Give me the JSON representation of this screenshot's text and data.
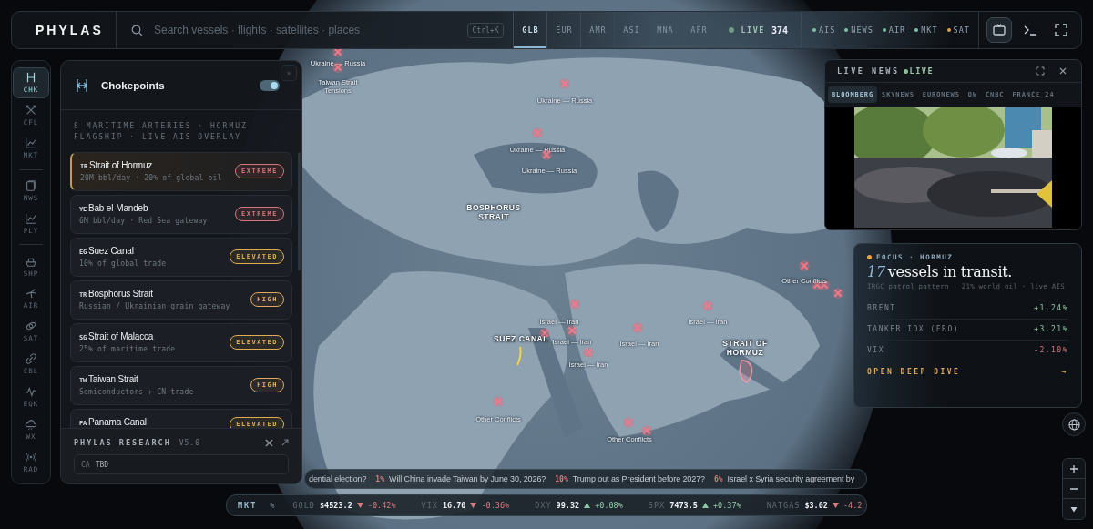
{
  "topbar": {
    "brand": "PHYLAS",
    "search": {
      "placeholder": "Search vessels · flights · satellites · places",
      "shortcut": "Ctrl+K"
    },
    "regions": [
      {
        "label": "GLB",
        "selected": true
      },
      {
        "label": "EUR",
        "selected": false
      },
      {
        "label": "AMR",
        "selected": false
      },
      {
        "label": "ASI",
        "selected": false
      },
      {
        "label": "MNA",
        "selected": false
      },
      {
        "label": "AFR",
        "selected": false
      }
    ],
    "live": {
      "label": "LIVE",
      "count": "374"
    },
    "layers": [
      {
        "label": "AIS",
        "color": "#7fc4a4"
      },
      {
        "label": "NEWS",
        "color": "#7fc4a4"
      },
      {
        "label": "AIR",
        "color": "#7fc4a4"
      },
      {
        "label": "MKT",
        "color": "#7fc4a4"
      },
      {
        "label": "SAT",
        "color": "#e0a050"
      }
    ],
    "tools": [
      {
        "kind": "tv",
        "selected": true
      },
      {
        "kind": "terminal",
        "selected": false
      },
      {
        "kind": "fullscreen",
        "selected": false
      }
    ]
  },
  "sidebar": {
    "groups": [
      {
        "items": [
          {
            "label": "CHK",
            "selected": true
          },
          {
            "label": "CFL",
            "selected": false
          },
          {
            "label": "MKT",
            "selected": false
          }
        ]
      },
      {
        "items": [
          {
            "label": "NWS",
            "selected": false
          },
          {
            "label": "PLY",
            "selected": false
          }
        ]
      },
      {
        "items": [
          {
            "label": "SHP",
            "selected": false
          },
          {
            "label": "AIR",
            "selected": false
          },
          {
            "label": "SAT",
            "selected": false
          },
          {
            "label": "CBL",
            "selected": false
          },
          {
            "label": "EQK",
            "selected": false
          },
          {
            "label": "WX",
            "selected": false
          },
          {
            "label": "RAD",
            "selected": false
          }
        ]
      }
    ]
  },
  "chokepoints": {
    "title": "Chokepoints",
    "enabled": true,
    "description": "8 MARITIME ARTERIES · HORMUZ FLAGSHIP · LIVE AIS OVERLAY",
    "items": [
      {
        "code": "IR",
        "name": "Strait of Hormuz",
        "detail": "20M bbl/day · 20% of global oil",
        "severity": "EXTREME",
        "kind": "extreme",
        "selected": true
      },
      {
        "code": "YE",
        "name": "Bab el-Mandeb",
        "detail": "6M bbl/day · Red Sea gateway",
        "severity": "EXTREME",
        "kind": "extreme",
        "selected": false
      },
      {
        "code": "EG",
        "name": "Suez Canal",
        "detail": "10% of global trade",
        "severity": "ELEVATED",
        "kind": "elevated",
        "selected": false
      },
      {
        "code": "TR",
        "name": "Bosphorus Strait",
        "detail": "Russian / Ukrainian grain gateway",
        "severity": "HIGH",
        "kind": "high",
        "selected": false
      },
      {
        "code": "SG",
        "name": "Strait of Malacca",
        "detail": "25% of maritime trade",
        "severity": "ELEVATED",
        "kind": "elevated",
        "selected": false
      },
      {
        "code": "TW",
        "name": "Taiwan Strait",
        "detail": "Semiconductors + CN trade",
        "severity": "HIGH",
        "kind": "high",
        "selected": false
      },
      {
        "code": "PA",
        "name": "Panama Canal",
        "severity": "ELEVATED",
        "kind": "elevated",
        "selected": false
      }
    ],
    "footer": {
      "title": "PHYLAS RESEARCH",
      "version": "V5.0",
      "field_label": "CA",
      "field_value": "TBD"
    }
  },
  "live_news": {
    "title": "LIVE NEWS",
    "status": "LIVE",
    "channels": [
      {
        "label": "BLOOMBERG",
        "selected": true
      },
      {
        "label": "SKYNEWS",
        "selected": false
      },
      {
        "label": "EURONEWS",
        "selected": false
      },
      {
        "label": "DW",
        "selected": false
      },
      {
        "label": "CNBC",
        "selected": false
      },
      {
        "label": "FRANCE 24",
        "selected": false
      }
    ]
  },
  "focus": {
    "tag": "FOCUS · HORMUZ",
    "count": "17",
    "headline": "vessels in transit.",
    "subtitle": "IRGC patrol pattern · 21% world oil · live AIS",
    "rows": [
      {
        "label": "BRENT",
        "value": "+1.24%",
        "rising": true
      },
      {
        "label": "TANKER IDX (FRO)",
        "value": "+3.21%",
        "rising": true
      },
      {
        "label": "VIX",
        "value": "-2.10%",
        "rising": false
      }
    ],
    "action": "OPEN DEEP DIVE",
    "action_arrow": "→"
  },
  "map": {
    "conflicts": [
      "Ukraine — Russia",
      "Taiwan Strait Tensions",
      "Ukraine — Russia",
      "Ukraine — Russia",
      "Ukraine — Russia",
      "Israel — Iran",
      "Israel — Iran",
      "Israel — Iran",
      "Israel — Iran",
      "Israel — Iran",
      "Other Conflicts",
      "Other Conflicts",
      "Other Conflicts"
    ],
    "straits": [
      "BOSPHORUS STRAIT",
      "SUEZ CANAL",
      "STRAIT OF HORMUZ"
    ]
  },
  "predictions": [
    {
      "text": "dential election?"
    },
    {
      "odds": "1%",
      "text": "Will China invade Taiwan by June 30, 2026?"
    },
    {
      "odds": "10%",
      "text": "Trump out as President before 2027?"
    },
    {
      "odds": "6%",
      "text": "Israel x Syria security agreement by"
    }
  ],
  "markets": {
    "label": "MKT",
    "unit": "%",
    "items": [
      {
        "name": "GOLD",
        "value": "$4523.2",
        "rising": false,
        "change": "-0.42%"
      },
      {
        "name": "VIX",
        "value": "16.70",
        "rising": false,
        "change": "-0.36%"
      },
      {
        "name": "DXY",
        "value": "99.32",
        "rising": true,
        "change": "+0.08%"
      },
      {
        "name": "SPX",
        "value": "7473.5",
        "rising": true,
        "change": "+0.37%"
      },
      {
        "name": "NATGAS",
        "value": "$3.02",
        "rising": false,
        "change": "-4.2"
      }
    ]
  }
}
